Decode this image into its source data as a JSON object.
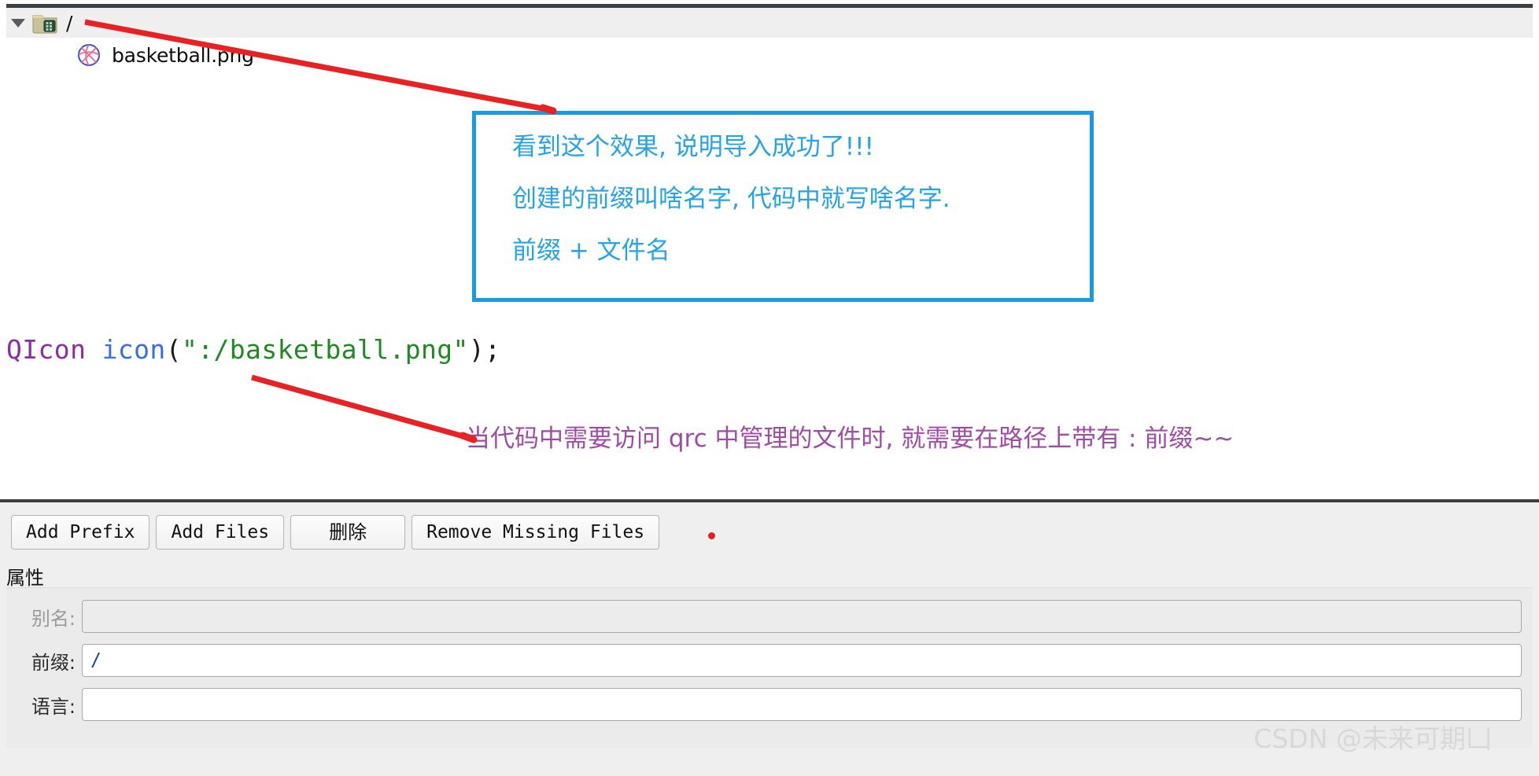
{
  "tree": {
    "expand_icon": "chevron-down-icon",
    "folder_icon": "qrc-folder-icon",
    "prefix_label": "/",
    "file_icon": "basketball-image-icon",
    "file_name": "basketball.png"
  },
  "callout": {
    "border_color": "#1a9ae0",
    "text_color": "#23a3e8",
    "lines": [
      "看到这个效果, 说明导入成功了!!!",
      "创建的前缀叫啥名字, 代码中就写啥名字.",
      "前缀 + 文件名"
    ]
  },
  "code": {
    "type_token": "QIcon",
    "space1": " ",
    "var_token": "icon",
    "open_paren": "(",
    "string_token": "\":/basketball.png\"",
    "close_paren": ")",
    "semicolon": ";",
    "colors": {
      "type": "#8b2fa0",
      "var": "#3b6fd8",
      "string": "#1f8a21",
      "punct": "#1a1a1a"
    }
  },
  "annotation": {
    "text": "当代码中需要访问 qrc 中管理的文件时, 就需要在路径上带有 : 前缀~~",
    "color": "#a24aa8"
  },
  "toolbar": {
    "buttons": [
      {
        "label": "Add Prefix",
        "cjk": false
      },
      {
        "label": "Add Files",
        "cjk": false
      },
      {
        "label": "删除",
        "cjk": true
      },
      {
        "label": "Remove Missing Files",
        "cjk": false
      }
    ],
    "marker_color": "#e02222"
  },
  "properties": {
    "title": "属性",
    "fields": [
      {
        "label": "别名:",
        "value": "",
        "disabled": true
      },
      {
        "label": "前缀:",
        "value": "/",
        "disabled": false
      },
      {
        "label": "语言:",
        "value": "",
        "disabled": false
      }
    ]
  },
  "watermark": {
    "text": "CSDN @未来可期凵"
  }
}
